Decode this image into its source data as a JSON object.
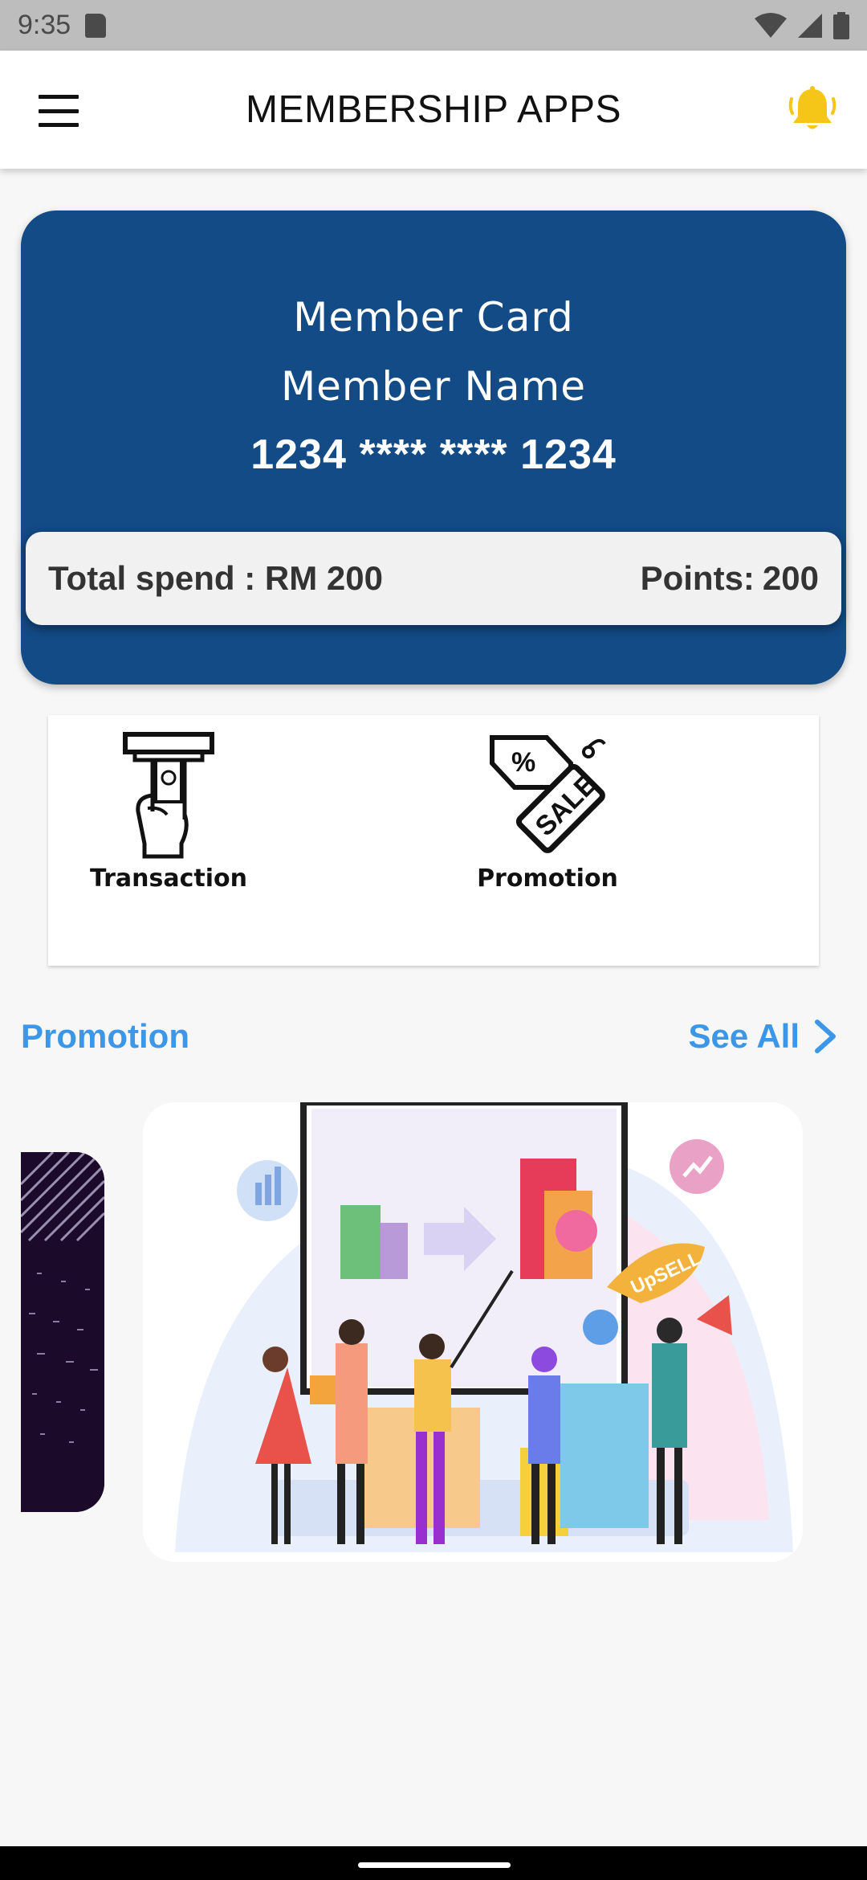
{
  "status_bar": {
    "time": "9:35"
  },
  "app_bar": {
    "title": "MEMBERSHIP APPS"
  },
  "member_card": {
    "title": "Member Card",
    "name": "Member Name",
    "number": "1234 **** **** 1234",
    "total_spend": "Total spend : RM 200",
    "points_label": "Points:",
    "points_value": "200"
  },
  "quick_actions": [
    {
      "label": "Transaction",
      "icon": "atm-withdraw-icon"
    },
    {
      "label": "Promotion",
      "icon": "sale-tag-icon"
    }
  ],
  "promotion_section": {
    "title": "Promotion",
    "see_all": "See All"
  },
  "colors": {
    "card": "#134b87",
    "accent": "#3c97e8",
    "bell": "#f5c518"
  }
}
